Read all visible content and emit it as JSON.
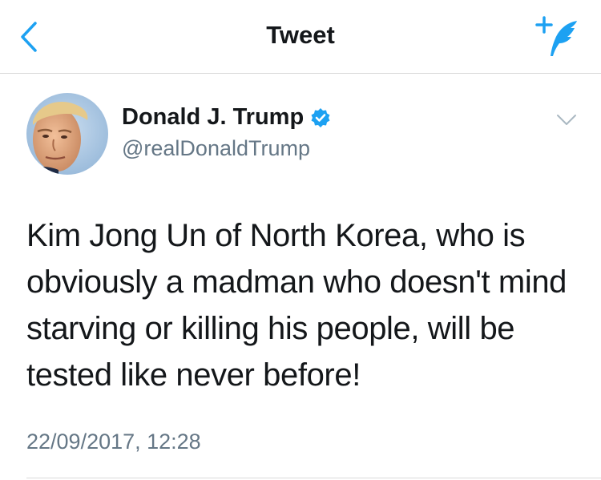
{
  "navbar": {
    "title": "Tweet",
    "back_icon": "chevron-left-icon",
    "compose_icon": "compose-tweet-icon",
    "accent_color": "#1da1f2"
  },
  "tweet": {
    "author": {
      "display_name": "Donald J. Trump",
      "handle": "@realDonaldTrump",
      "verified": true,
      "verified_icon": "verified-badge-icon"
    },
    "text": "Kim Jong Un of North Korea, who is obviously a madman who doesn't mind starving or killing his people, will be tested like never before!",
    "timestamp": "22/09/2017, 12:28",
    "menu_icon": "chevron-down-icon"
  }
}
